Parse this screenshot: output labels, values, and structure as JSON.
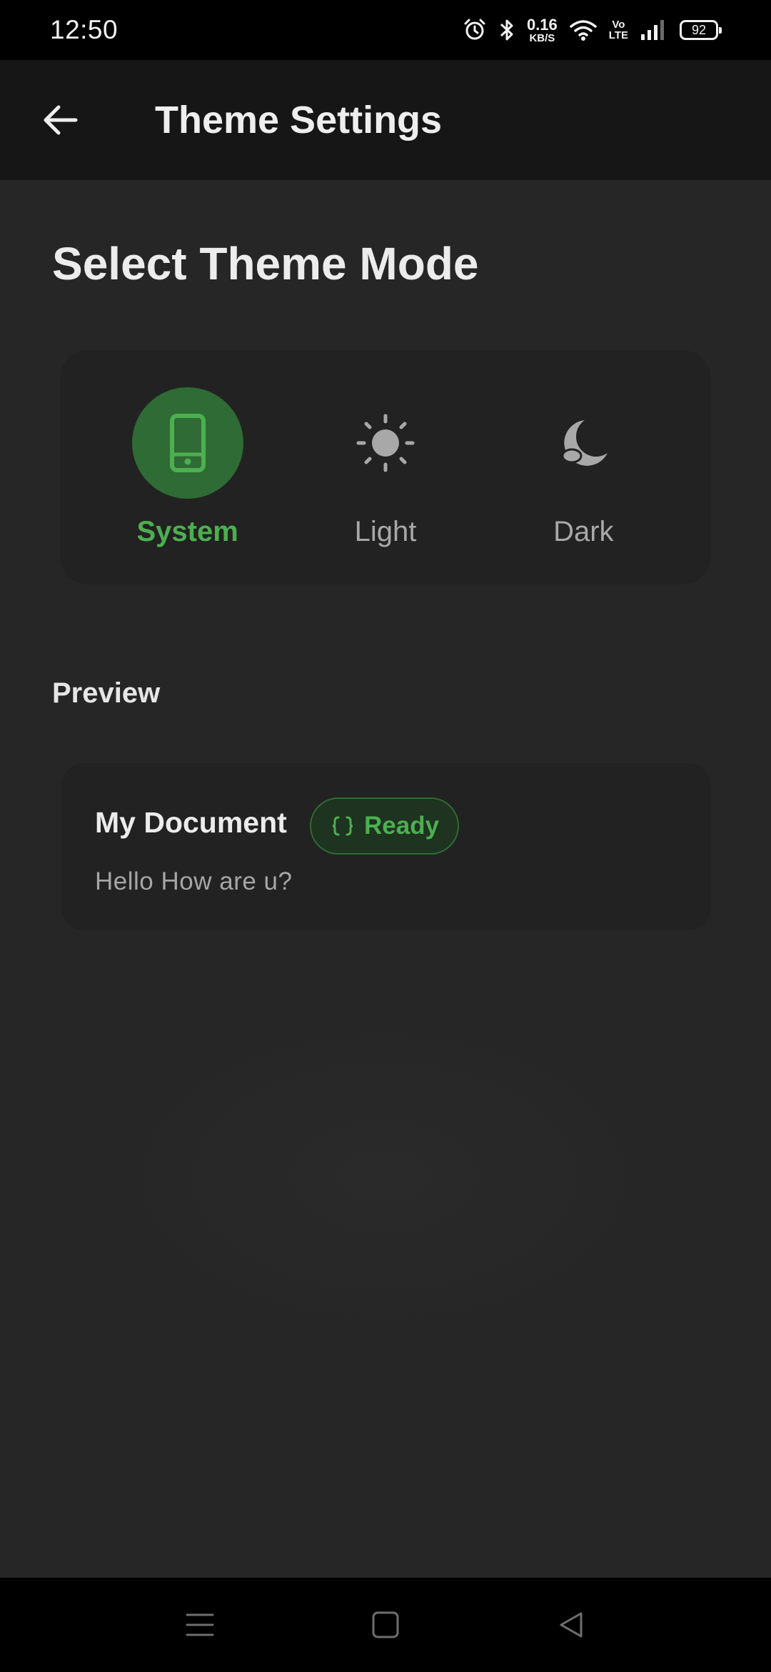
{
  "status_bar": {
    "time": "12:50",
    "net_speed_value": "0.16",
    "net_speed_unit": "KB/S",
    "volte_top": "Vo",
    "volte_bottom": "LTE",
    "battery": "92",
    "icons": [
      "alarm-icon",
      "bluetooth-icon",
      "wifi-icon",
      "signal-icon",
      "battery-icon"
    ]
  },
  "app_bar": {
    "back_icon": "arrow-left-icon",
    "title": "Theme Settings"
  },
  "theme_section": {
    "title": "Select Theme Mode",
    "selected": "System",
    "options": [
      {
        "label": "System",
        "icon": "phone-icon"
      },
      {
        "label": "Light",
        "icon": "sun-icon"
      },
      {
        "label": "Dark",
        "icon": "moon-icon"
      }
    ]
  },
  "preview": {
    "title": "Preview",
    "document_title": "My Document",
    "status_chip": "Ready",
    "status_icon": "braces-icon",
    "body": "Hello How are u?"
  },
  "nav_bar": {
    "icons": [
      "menu-icon",
      "home-square-icon",
      "back-triangle-icon"
    ]
  },
  "colors": {
    "accent": "#4caf50",
    "accent_dark": "#2f6b34",
    "background": "#262626",
    "card": "#222222",
    "app_bar": "#161616"
  }
}
